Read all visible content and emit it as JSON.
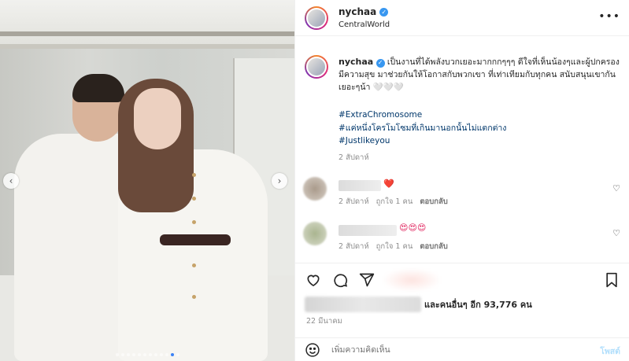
{
  "post": {
    "username": "nychaa",
    "location": "CentralWorld",
    "caption": "เป็นงานที่ได้พลังบวกเยอะมากกกๆๆๆ ดีใจที่เห็นน้องๆและผู้ปกครองมีความสุข มาช่วยกันให้โอกาสกับพวกเขา ที่เท่าเทียมกับทุกคน สนับสนุนเขากันเยอะๆน้า 🤍🤍🤍",
    "hashtags": [
      "#ExtraChromosome",
      "#แค่หนึ่งโครโมโซมที่เกินมานอกนั้นไม่แตกต่าง",
      "#Justlikeyou"
    ],
    "caption_time": "2 สัปดาห์",
    "more_label": "•••"
  },
  "comments": [
    {
      "text": "❤️",
      "time": "2 สัปดาห์",
      "likes": "ถูกใจ 1 คน",
      "reply": "ตอบกลับ"
    },
    {
      "text": "😍😍😍",
      "time": "2 สัปดาห์",
      "likes": "ถูกใจ 1 คน",
      "reply": "ตอบกลับ"
    }
  ],
  "likes_text": "และคนอื่นๆ อีก 93,776 คน",
  "post_date": "22 มีนาคม",
  "comment_box": {
    "placeholder": "เพิ่มความคิดเห็น",
    "post_label": "โพสต์"
  },
  "media": {
    "slide_count": 12,
    "active_slide": 10
  },
  "icons": {
    "verified": "verified-badge-icon",
    "heart": "heart-icon",
    "comment": "comment-icon",
    "share": "share-icon",
    "save": "bookmark-icon",
    "emoji": "emoji-icon",
    "prev": "chevron-left-icon",
    "next": "chevron-right-icon"
  },
  "colors": {
    "link": "#00376b",
    "verified": "#3897f0",
    "post_btn": "#b2dffc",
    "meta": "#8e8e8e"
  }
}
